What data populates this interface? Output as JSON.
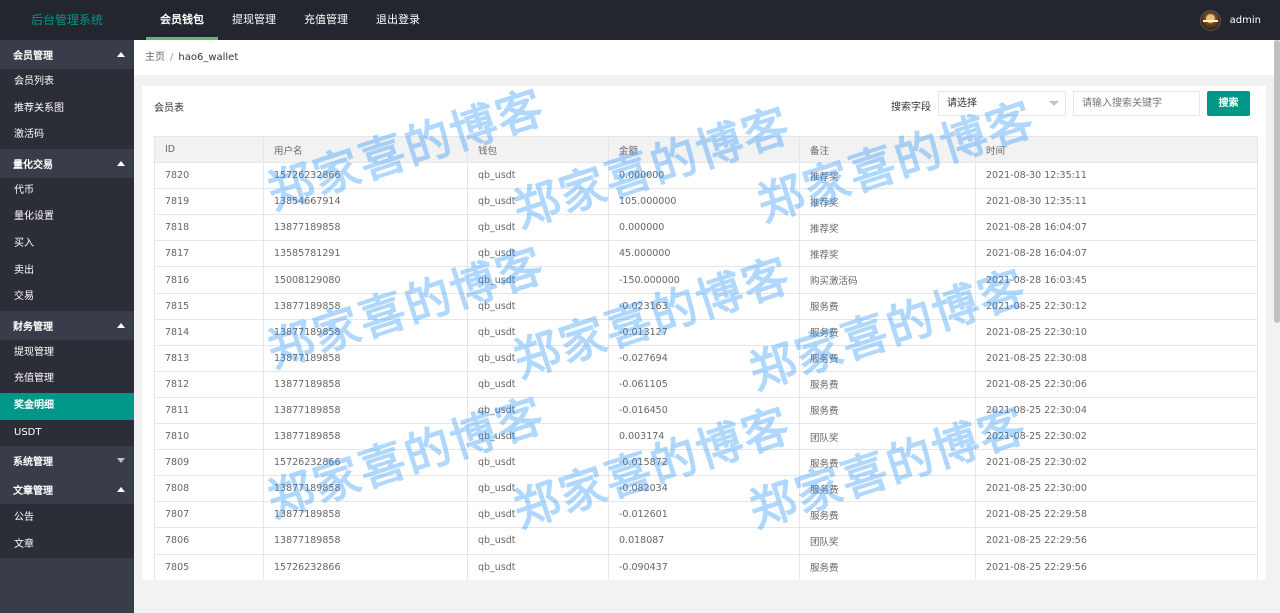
{
  "header": {
    "logo": "后台管理系统",
    "nav": [
      {
        "label": "会员钱包",
        "active": true
      },
      {
        "label": "提现管理",
        "active": false
      },
      {
        "label": "充值管理",
        "active": false
      },
      {
        "label": "退出登录",
        "active": false
      }
    ],
    "username": "admin"
  },
  "sidebar": {
    "groups": [
      {
        "label": "会员管理",
        "expanded": true,
        "items": [
          "会员列表",
          "推荐关系图",
          "激活码"
        ]
      },
      {
        "label": "量化交易",
        "expanded": true,
        "items": [
          "代币",
          "量化设置",
          "买入",
          "卖出",
          "交易"
        ]
      },
      {
        "label": "财务管理",
        "expanded": true,
        "items": [
          "提现管理",
          "充值管理",
          "奖金明细",
          "USDT"
        ]
      },
      {
        "label": "系统管理",
        "expanded": false,
        "items": []
      },
      {
        "label": "文章管理",
        "expanded": true,
        "items": [
          "公告",
          "文章"
        ]
      }
    ],
    "active_item": "奖金明细"
  },
  "breadcrumb": {
    "home": "主页",
    "separator": "/",
    "current": "hao6_wallet"
  },
  "card": {
    "title": "会员表",
    "search_label": "搜索字段",
    "select_value": "请选择",
    "search_placeholder": "请输入搜索关键字",
    "search_button": "搜索"
  },
  "table": {
    "columns": [
      "ID",
      "用户名",
      "钱包",
      "金额",
      "备注",
      "时间"
    ],
    "rows": [
      [
        "7820",
        "15726232866",
        "qb_usdt",
        "0.000000",
        "推荐奖",
        "2021-08-30 12:35:11"
      ],
      [
        "7819",
        "13854667914",
        "qb_usdt",
        "105.000000",
        "推荐奖",
        "2021-08-30 12:35:11"
      ],
      [
        "7818",
        "13877189858",
        "qb_usdt",
        "0.000000",
        "推荐奖",
        "2021-08-28 16:04:07"
      ],
      [
        "7817",
        "13585781291",
        "qb_usdt",
        "45.000000",
        "推荐奖",
        "2021-08-28 16:04:07"
      ],
      [
        "7816",
        "15008129080",
        "qb_usdt",
        "-150.000000",
        "购买激活码",
        "2021-08-28 16:03:45"
      ],
      [
        "7815",
        "13877189858",
        "qb_usdt",
        "-0.023163",
        "服务费",
        "2021-08-25 22:30:12"
      ],
      [
        "7814",
        "13877189858",
        "qb_usdt",
        "-0.013127",
        "服务费",
        "2021-08-25 22:30:10"
      ],
      [
        "7813",
        "13877189858",
        "qb_usdt",
        "-0.027694",
        "服务费",
        "2021-08-25 22:30:08"
      ],
      [
        "7812",
        "13877189858",
        "qb_usdt",
        "-0.061105",
        "服务费",
        "2021-08-25 22:30:06"
      ],
      [
        "7811",
        "13877189858",
        "qb_usdt",
        "-0.016450",
        "服务费",
        "2021-08-25 22:30:04"
      ],
      [
        "7810",
        "13877189858",
        "qb_usdt",
        "0.003174",
        "团队奖",
        "2021-08-25 22:30:02"
      ],
      [
        "7809",
        "15726232866",
        "qb_usdt",
        "-0.015872",
        "服务费",
        "2021-08-25 22:30:02"
      ],
      [
        "7808",
        "13877189858",
        "qb_usdt",
        "-0.082034",
        "服务费",
        "2021-08-25 22:30:00"
      ],
      [
        "7807",
        "13877189858",
        "qb_usdt",
        "-0.012601",
        "服务费",
        "2021-08-25 22:29:58"
      ],
      [
        "7806",
        "13877189858",
        "qb_usdt",
        "0.018087",
        "团队奖",
        "2021-08-25 22:29:56"
      ],
      [
        "7805",
        "15726232866",
        "qb_usdt",
        "-0.090437",
        "服务费",
        "2021-08-25 22:29:56"
      ]
    ]
  },
  "watermark": {
    "text": "郑家喜的博客",
    "color": "#1e90ff"
  },
  "colors": {
    "header_bg": "#23262e",
    "sidebar_bg": "#393d49",
    "accent": "#009688",
    "nav_underline": "#5fb878"
  }
}
